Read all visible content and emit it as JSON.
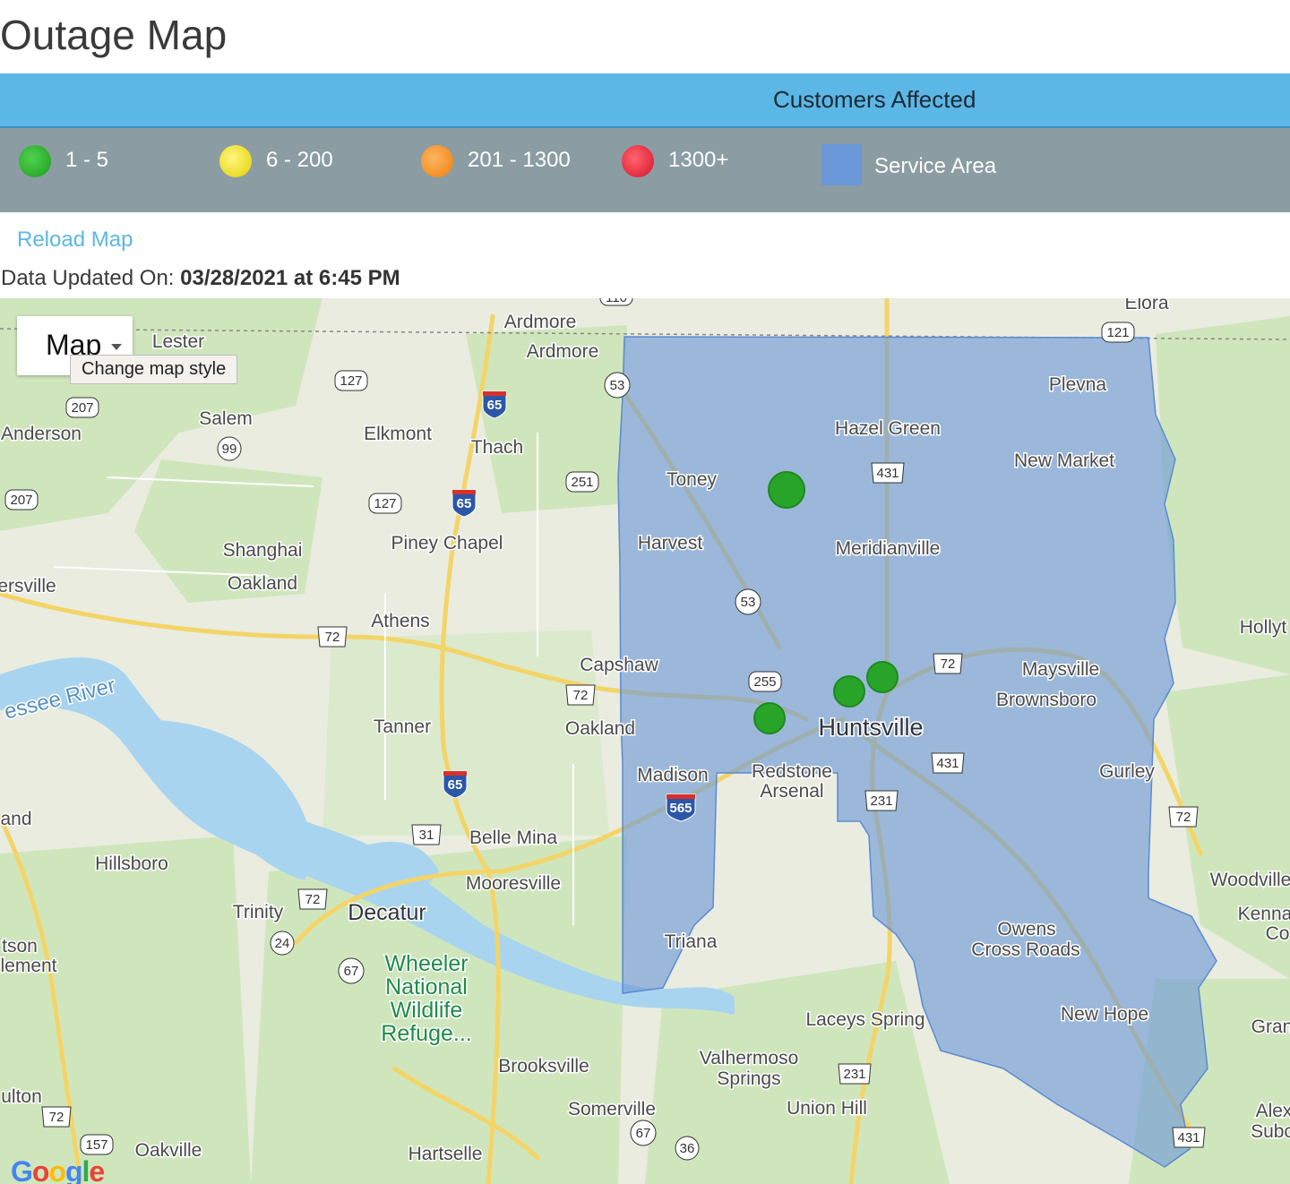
{
  "page": {
    "title": "Outage Map"
  },
  "legend": {
    "header": "Customers Affected",
    "items": [
      {
        "label": "1 - 5",
        "color": "#2bb52b"
      },
      {
        "label": "6 - 200",
        "color": "#f4e31c"
      },
      {
        "label": "201 - 1300",
        "color": "#f6961f"
      },
      {
        "label": "1300+",
        "color": "#e8293a"
      }
    ],
    "service_area": {
      "label": "Service Area",
      "color": "#6a98d8"
    }
  },
  "reload_label": "Reload Map",
  "updated": {
    "prefix": "Data Updated On: ",
    "value": "03/28/2021 at 6:45 PM"
  },
  "map": {
    "style_button": "Map",
    "style_tooltip": "Change map style",
    "google_logo": "Google",
    "places": [
      "Elora",
      "Ardmore",
      "Ardmore",
      "Lester",
      "Plevna",
      "Salem",
      "Anderson",
      "Elkmont",
      "Thach",
      "Hazel Green",
      "New Market",
      "Toney",
      "Harvest",
      "Meridianville",
      "Shanghai",
      "Oakland",
      "Piney Chapel",
      "ersville",
      "Athens",
      "Hollyt",
      "Capshaw",
      "Maysville",
      "Brownsboro",
      "Tanner",
      "Oakland",
      "Huntsville",
      "Madison",
      "Redstone",
      "Arsenal",
      "Gurley",
      "and",
      "Belle Mina",
      "Hillsboro",
      "Mooresville",
      "Woodville",
      "Trinity",
      "Decatur",
      "Kenna",
      "Co",
      "Owens",
      "Cross Roads",
      "tson",
      "lement",
      "Triana",
      "Wheeler",
      "National",
      "Wildlife",
      "Refuge...",
      "Laceys Spring",
      "New Hope",
      "Gran",
      "Valhermoso",
      "Springs",
      "Brooksville",
      "ulton",
      "Somerville",
      "Union Hill",
      "Alex",
      "Subc",
      "Oakville",
      "Hartselle"
    ],
    "river_label": "essee River",
    "shields": [
      "110",
      "121",
      "127",
      "65",
      "53",
      "207",
      "99",
      "431",
      "207",
      "127",
      "251",
      "65",
      "53",
      "72",
      "72",
      "255",
      "72",
      "431",
      "65",
      "565",
      "231",
      "72",
      "31",
      "72",
      "72",
      "24",
      "67",
      "231",
      "67",
      "36",
      "157",
      "431"
    ],
    "outages": [
      {
        "level": "1 - 5"
      },
      {
        "level": "1 - 5"
      },
      {
        "level": "1 - 5"
      },
      {
        "level": "1 - 5"
      }
    ]
  }
}
